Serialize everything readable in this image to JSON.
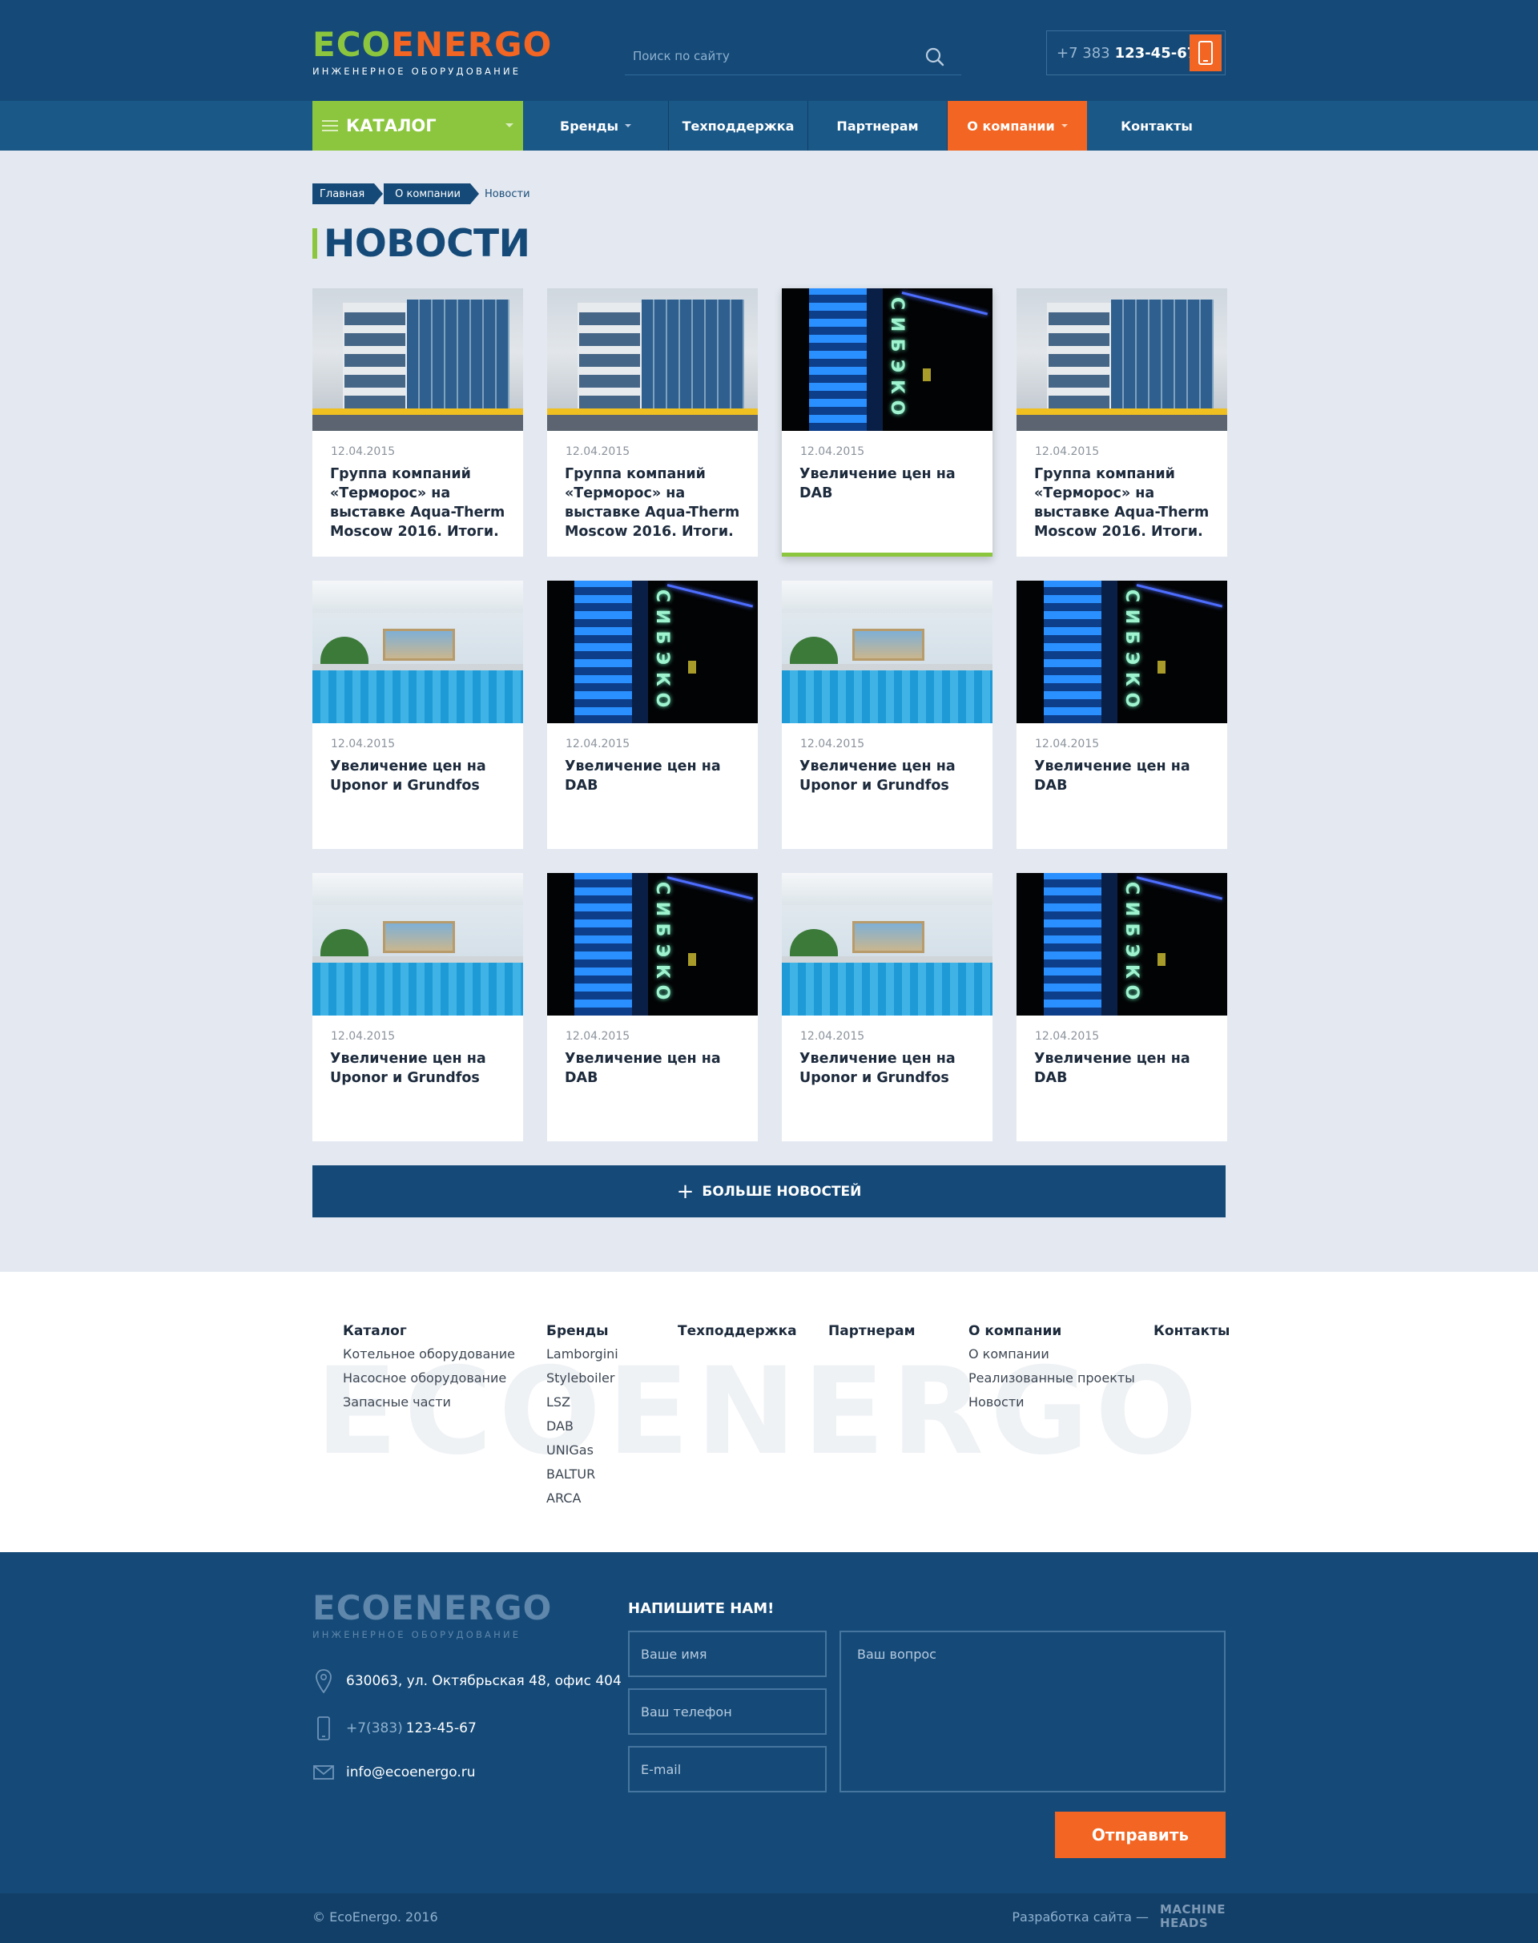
{
  "header": {
    "logo": {
      "eco": "ECO",
      "energo": "ENERGO",
      "subtitle": "ИНЖЕНЕРНОЕ ОБОРУДОВАНИЕ"
    },
    "search": {
      "placeholder": "Поиск по сайту",
      "icon": "search-icon"
    },
    "phone": {
      "prefix": "+7 383",
      "number": "123-45-67",
      "icon": "phone-icon"
    }
  },
  "nav": {
    "catalog": "КАТАЛОГ",
    "items": [
      {
        "label": "Бренды",
        "has_dropdown": true
      },
      {
        "label": "Техподдержка",
        "has_dropdown": false
      },
      {
        "label": "Партнерам",
        "has_dropdown": false
      },
      {
        "label": "О компании",
        "has_dropdown": true,
        "active": true
      },
      {
        "label": "Контакты",
        "has_dropdown": false
      }
    ]
  },
  "breadcrumb": [
    "Главная",
    "О компании",
    "Новости"
  ],
  "page_title": "НОВОСТИ",
  "news": [
    {
      "date": "12.04.2015",
      "title": "Группа компаний «Терморос» на выставке Aqua-Therm Moscow 2016. Итоги.",
      "image": "building-photo"
    },
    {
      "date": "12.04.2015",
      "title": "Группа компаний «Терморос» на выставке Aqua-Therm Moscow 2016. Итоги.",
      "image": "building-photo"
    },
    {
      "date": "12.04.2015",
      "title": "Увеличение цен на DAB",
      "image": "tower-photo",
      "featured": true
    },
    {
      "date": "12.04.2015",
      "title": "Группа компаний «Терморос» на выставке Aqua-Therm Moscow 2016. Итоги.",
      "image": "building-photo"
    },
    {
      "date": "12.04.2015",
      "title": "Увеличение цен на Uponor и Grundfos",
      "image": "pool-photo"
    },
    {
      "date": "12.04.2015",
      "title": "Увеличение цен на DAB",
      "image": "tower-photo"
    },
    {
      "date": "12.04.2015",
      "title": "Увеличение цен на Uponor и Grundfos",
      "image": "pool-photo"
    },
    {
      "date": "12.04.2015",
      "title": "Увеличение цен на DAB",
      "image": "tower-photo"
    },
    {
      "date": "12.04.2015",
      "title": "Увеличение цен на Uponor и Grundfos",
      "image": "pool-photo"
    },
    {
      "date": "12.04.2015",
      "title": "Увеличение цен на DAB",
      "image": "tower-photo"
    },
    {
      "date": "12.04.2015",
      "title": "Увеличение цен на Uponor и Grundfos",
      "image": "pool-photo"
    },
    {
      "date": "12.04.2015",
      "title": "Увеличение цен на DAB",
      "image": "tower-photo"
    }
  ],
  "tower_sign": "СИБЭКО",
  "more_button": {
    "icon": "plus-icon",
    "label": "БОЛЬШЕ НОВОСТЕЙ"
  },
  "footer_links": {
    "watermark": "ECOENERGO",
    "columns": [
      {
        "heading": "Каталог",
        "links": [
          "Котельное оборудование",
          "Насосное оборудование",
          "Запасные части"
        ]
      },
      {
        "heading": "Бренды",
        "links": [
          "Lamborgini",
          "Styleboiler",
          "LSZ",
          "DAB",
          "UNIGas",
          "BALTUR",
          "ARCA"
        ]
      },
      {
        "heading": "Техподдержка",
        "links": []
      },
      {
        "heading": "Партнерам",
        "links": []
      },
      {
        "heading": "О компании",
        "links": [
          "О компании",
          "Реализованные проекты",
          "Новости"
        ]
      },
      {
        "heading": "Контакты",
        "links": []
      }
    ]
  },
  "footer": {
    "logo": {
      "text": "ECOENERGO",
      "subtitle": "ИНЖЕНЕРНОЕ ОБОРУДОВАНИЕ"
    },
    "address": "630063, ул. Октябрьская 48, офис 404",
    "phone_prefix": "+7(383)",
    "phone_number": "123-45-67",
    "email": "info@ecoenergo.ru",
    "form": {
      "title": "НАПИШИТЕ НАМ!",
      "name_placeholder": "Ваше имя",
      "phone_placeholder": "Ваш телефон",
      "email_placeholder": "E-mail",
      "question_placeholder": "Ваш вопрос",
      "submit": "Отправить"
    }
  },
  "bottom": {
    "copyright": "© EcoEnergo. 2016",
    "dev_label": "Разработка сайта —",
    "dev_logo_line1": "MACHINE",
    "dev_logo_line2": "HEADS"
  },
  "colors": {
    "primary": "#154a78",
    "accent_green": "#8cc63e",
    "accent_orange": "#f26522",
    "background": "#e4e9f1"
  }
}
